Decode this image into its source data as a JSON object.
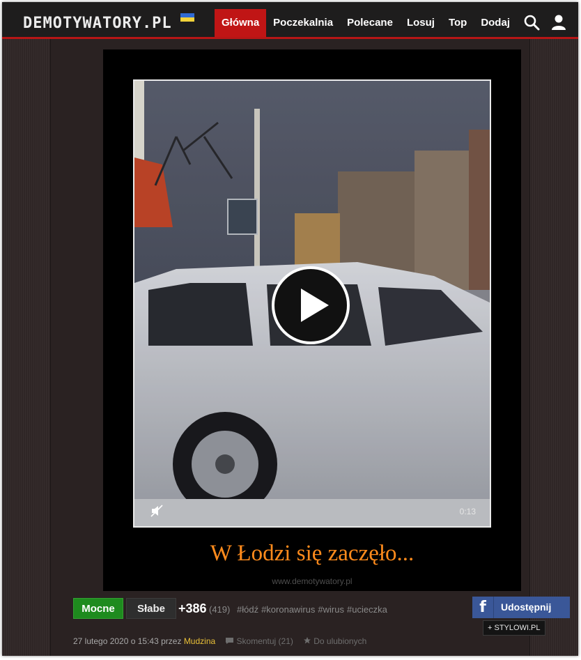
{
  "header": {
    "logo": "DEMOTYWATORY.PL",
    "nav": [
      "Główna",
      "Poczekalnia",
      "Polecane",
      "Losuj",
      "Top",
      "Dodaj"
    ],
    "active_nav": "Główna",
    "colors": {
      "accent": "#c01515",
      "flag_top": "#2f6ad3",
      "flag_bottom": "#f2d23a"
    }
  },
  "post": {
    "caption": "W Łodzi się zaczęło...",
    "watermark": "www.demotywatory.pl",
    "video": {
      "duration": "0:13",
      "icons": [
        "play-icon",
        "mute-icon"
      ]
    }
  },
  "votes": {
    "up_label": "Mocne",
    "down_label": "Słabe",
    "score": "+386",
    "count": "(419)"
  },
  "tags": [
    "#łódź",
    "#koronawirus",
    "#wirus",
    "#ucieczka"
  ],
  "share": {
    "facebook_label": "Udostępnij",
    "stylowi_label": "STYLOWI.PL"
  },
  "meta": {
    "date_text": "27 lutego 2020 o 15:43 przez",
    "author": "Mudzina",
    "comment_label": "Skomentuj (21)",
    "favorite_label": "Do ulubionych"
  }
}
